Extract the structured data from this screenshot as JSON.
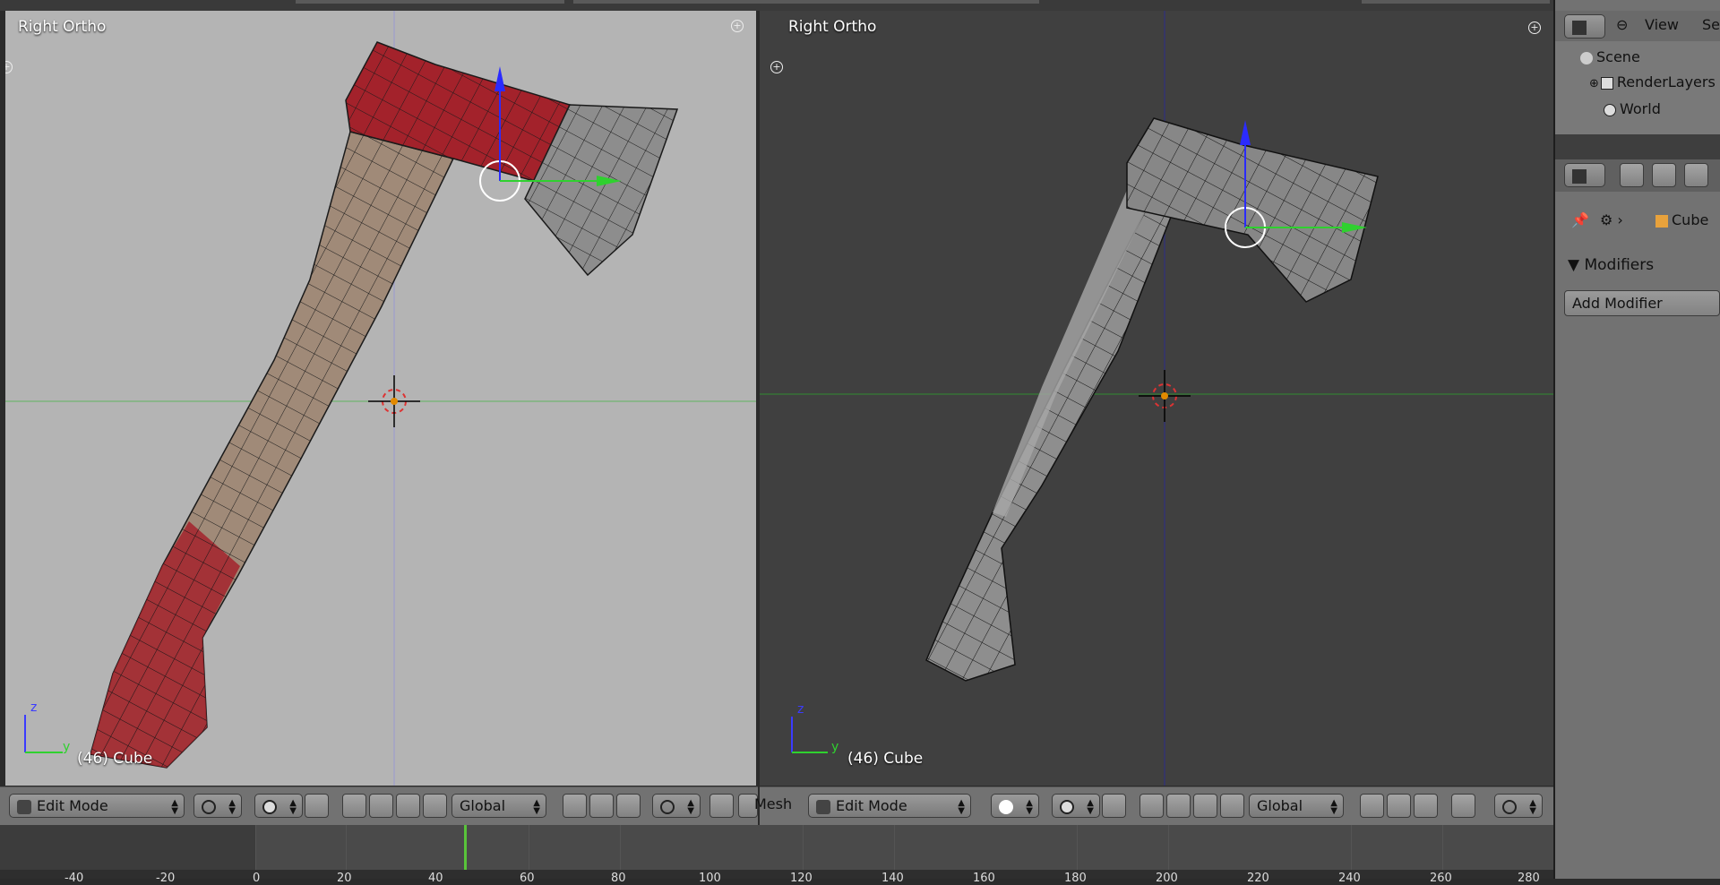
{
  "viewports": {
    "left": {
      "title": "Right Ortho",
      "object_label": "(46) Cube",
      "axis_z": "z",
      "axis_y": "y"
    },
    "right": {
      "title": "Right Ortho",
      "object_label": "(46) Cube",
      "axis_z": "z",
      "axis_y": "y"
    }
  },
  "header_left": {
    "mode": "Edit Mode",
    "orientation": "Global"
  },
  "header_right": {
    "menu_partial": "Mesh",
    "mode": "Edit Mode",
    "orientation": "Global"
  },
  "timeline": {
    "ticks": [
      "-40",
      "-20",
      "0",
      "20",
      "40",
      "60",
      "80",
      "100",
      "120",
      "140",
      "160",
      "180",
      "200",
      "220",
      "240",
      "260",
      "280"
    ]
  },
  "outliner": {
    "view_label": "View",
    "extra_label": "Se",
    "items": [
      "Scene",
      "RenderLayers",
      "World"
    ]
  },
  "properties": {
    "object_name": "Cube",
    "modifiers_title": "Modifiers",
    "add_modifier": "Add Modifier"
  },
  "colors": {
    "left_bg": "#b4b4b4",
    "right_bg": "#404040",
    "header": "#727272",
    "red_seam": "#a3222b",
    "axis_x": "#2fd12f",
    "axis_z": "#2b2bff"
  }
}
